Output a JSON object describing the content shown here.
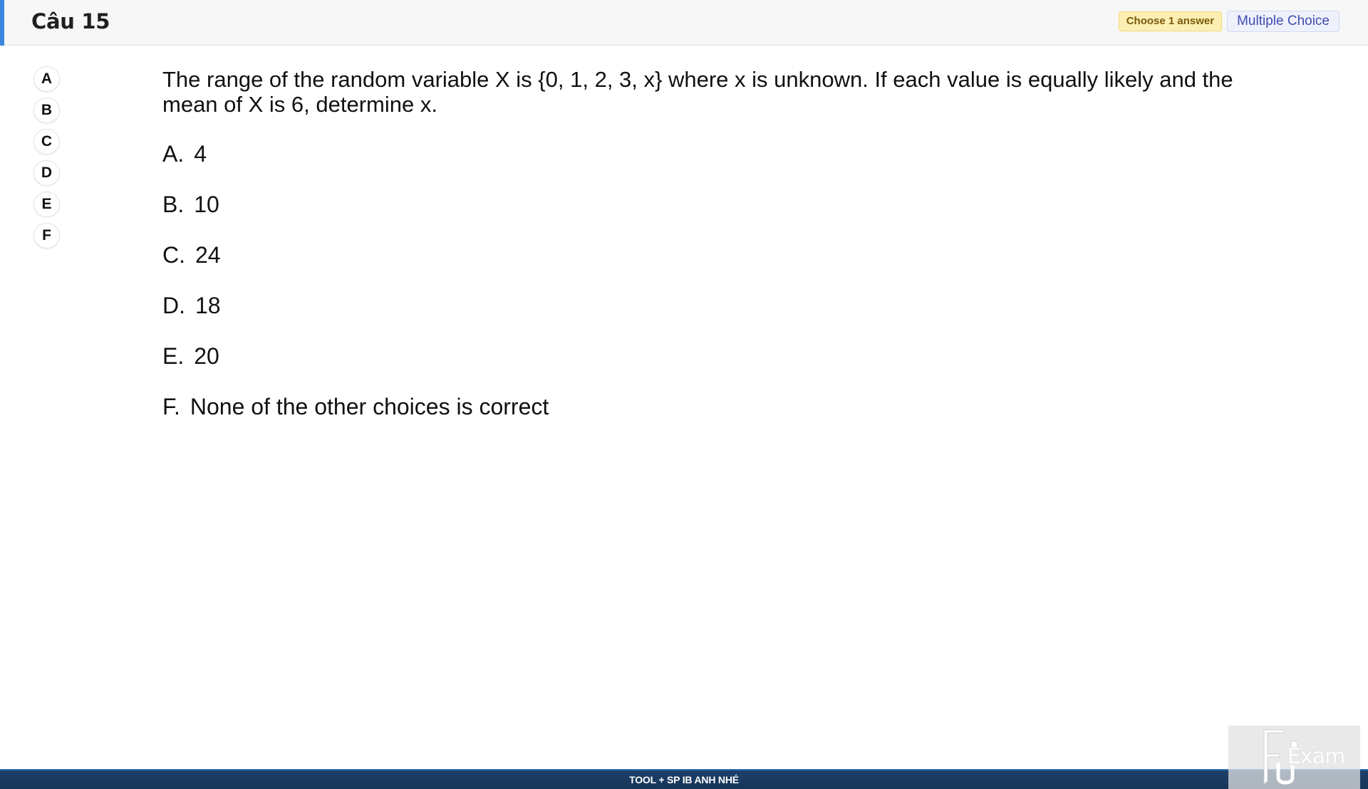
{
  "header": {
    "title": "Câu 15",
    "choose_badge": "Choose 1 answer",
    "type_badge": "Multiple Choice"
  },
  "answer_buttons": [
    "A",
    "B",
    "C",
    "D",
    "E",
    "F"
  ],
  "question": {
    "text": "The range of the random variable X is {0, 1, 2, 3, x} where x is unknown. If each value is equally likely and the mean of X is 6, determine x.",
    "choices": [
      {
        "letter": "A.",
        "text": "4"
      },
      {
        "letter": "B.",
        "text": "10"
      },
      {
        "letter": "C.",
        "text": "24"
      },
      {
        "letter": "D.",
        "text": "18"
      },
      {
        "letter": "E.",
        "text": "20"
      },
      {
        "letter": "F.",
        "text": "None of the other choices is correct"
      }
    ]
  },
  "footer": {
    "text": "TOOL + SP IB ANH NHÉ"
  },
  "logo": {
    "text": "Exam",
    "icon": "fu-exam-logo-icon"
  },
  "colors": {
    "accent": "#3d86e0",
    "badge_choose_bg": "#fdefb3",
    "badge_type_bg": "#eef0fb",
    "footer_bg": "#1d3f6a"
  }
}
